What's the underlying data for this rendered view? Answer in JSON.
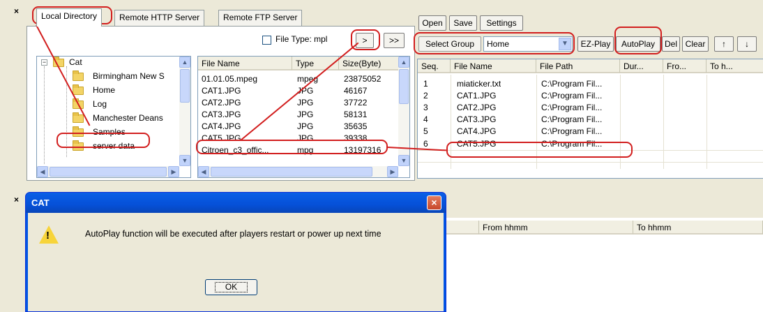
{
  "tabs": [
    "Local Directory",
    "Remote HTTP Server",
    "Remote FTP Server"
  ],
  "filetype": {
    "label": "File Type: mpl",
    "checked": false
  },
  "transfer_buttons": {
    "one": ">",
    "all": ">>"
  },
  "tree": {
    "root": "Cat",
    "expander": "−",
    "items": [
      "Birmingham New S",
      "Home",
      "Log",
      "Manchester Deans",
      "Samples",
      "server data"
    ]
  },
  "file_list": {
    "columns": [
      "File Name",
      "Type",
      "Size(Byte)"
    ],
    "rows": [
      [
        "01.01.05.mpeg",
        "mpeg",
        "23875052"
      ],
      [
        "CAT1.JPG",
        "JPG",
        "46167"
      ],
      [
        "CAT2.JPG",
        "JPG",
        "37722"
      ],
      [
        "CAT3.JPG",
        "JPG",
        "58131"
      ],
      [
        "CAT4.JPG",
        "JPG",
        "35635"
      ],
      [
        "CAT5.JPG",
        "JPG",
        "39338"
      ],
      [
        "Citroen_c3_offic...",
        "mpg",
        "13197316"
      ]
    ]
  },
  "toolbar": {
    "open": "Open",
    "save": "Save",
    "settings": "Settings"
  },
  "group": {
    "label": "Select Group",
    "value": "Home",
    "ezplay": "EZ-Play",
    "autoplay": "AutoPlay",
    "del": "Del",
    "clear": "Clear",
    "up": "↑",
    "down": "↓"
  },
  "playlist": {
    "columns": [
      "Seq.",
      "File Name",
      "File Path",
      "Dur...",
      "Fro...",
      "To h..."
    ],
    "rows": [
      [
        "1",
        "miaticker.txt",
        "C:\\Program Fil..."
      ],
      [
        "2",
        "CAT1.JPG",
        "C:\\Program Fil..."
      ],
      [
        "3",
        "CAT2.JPG",
        "C:\\Program Fil..."
      ],
      [
        "4",
        "CAT3.JPG",
        "C:\\Program Fil..."
      ],
      [
        "5",
        "CAT4.JPG",
        "C:\\Program Fil..."
      ],
      [
        "6",
        "CAT5.JPG",
        "C:\\Program Fil..."
      ]
    ]
  },
  "bottom_table": {
    "columns": [
      "From hhmm",
      "To hhmm"
    ]
  },
  "close_glyph": "×",
  "dialog": {
    "title": "CAT",
    "close": "×",
    "icon_glyph": "!",
    "message": "AutoPlay function will be executed after players restart or power up next time",
    "ok": "OK"
  },
  "scroll_glyphs": {
    "up": "▲",
    "down": "▼",
    "left": "◀",
    "right": "▶",
    "combo": "▼"
  },
  "colors": {
    "annotation": "#D21E1E",
    "title_bar": "#0054E3",
    "window_bg": "#ECE9D8"
  }
}
